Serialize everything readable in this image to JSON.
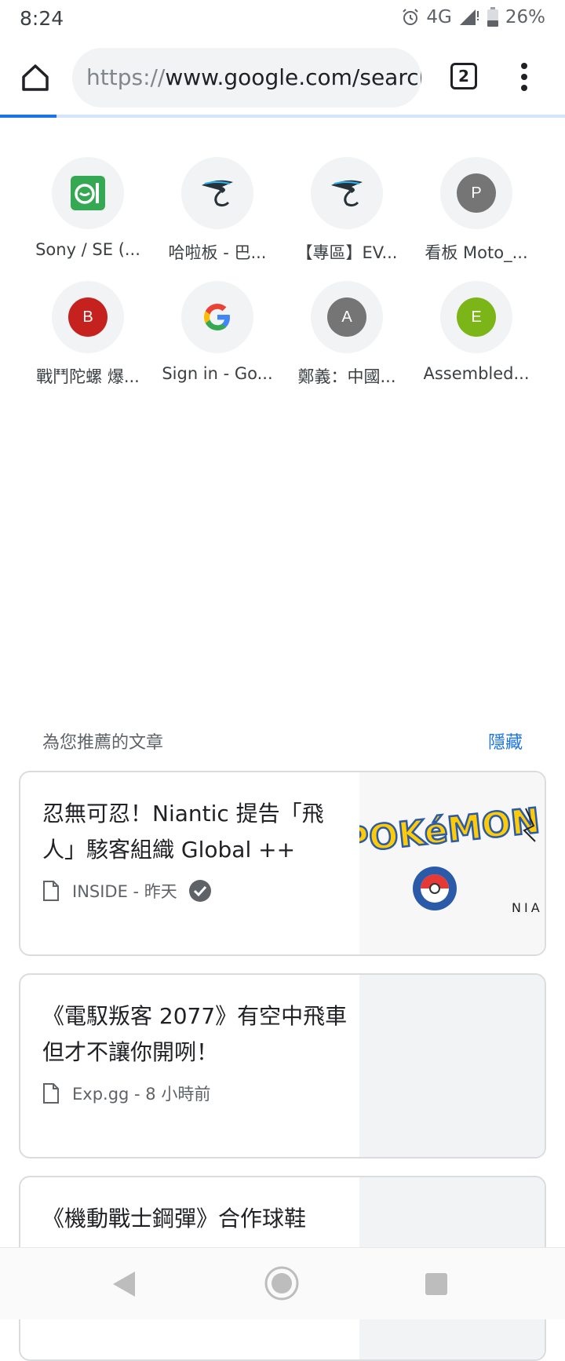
{
  "status_bar": {
    "time": "8:24",
    "network": "4G",
    "battery": "26%",
    "icons": [
      "alarm-icon",
      "signal-icon",
      "battery-icon"
    ]
  },
  "toolbar": {
    "url_scheme": "https://",
    "url_rest": "www.google.com/search",
    "tab_count": "2",
    "load_progress": 0.1
  },
  "tiles": [
    {
      "label": "Sony / SE (...",
      "icon": "green-app-icon"
    },
    {
      "label": "哈啦板 - 巴...",
      "icon": "bahamut-dragon-icon"
    },
    {
      "label": "【專區】EV...",
      "icon": "bahamut-dragon-icon"
    },
    {
      "label": "看板 Moto_...",
      "letter": "P",
      "color": "#757575"
    },
    {
      "label": "戰鬥陀螺 爆...",
      "letter": "B",
      "color": "#c5221f"
    },
    {
      "label": "Sign in - Go...",
      "icon": "google-g-icon"
    },
    {
      "label": "鄭義：中國...",
      "letter": "A",
      "color": "#757575"
    },
    {
      "label": "Assembled...",
      "letter": "E",
      "color": "#7cb518"
    }
  ],
  "articles": {
    "header": "為您推薦的文章",
    "hide_label": "隱藏",
    "items": [
      {
        "title": "忍無可忍！Niantic 提告「飛人」駭客組織 Global ++",
        "source": "INSIDE - 昨天",
        "thumb_text": "NIA",
        "thumb_logo": "POKéMON GO"
      },
      {
        "title": "《電馭叛客 2077》有空中飛車 但才不讓你開咧！",
        "source": "Exp.gg - 8 小時前"
      },
      {
        "title": "《機動戰士鋼彈》合作球鞋"
      }
    ]
  },
  "colors": {
    "accent": "#1a73e8",
    "url_bar_bg": "#f1f3f4"
  }
}
